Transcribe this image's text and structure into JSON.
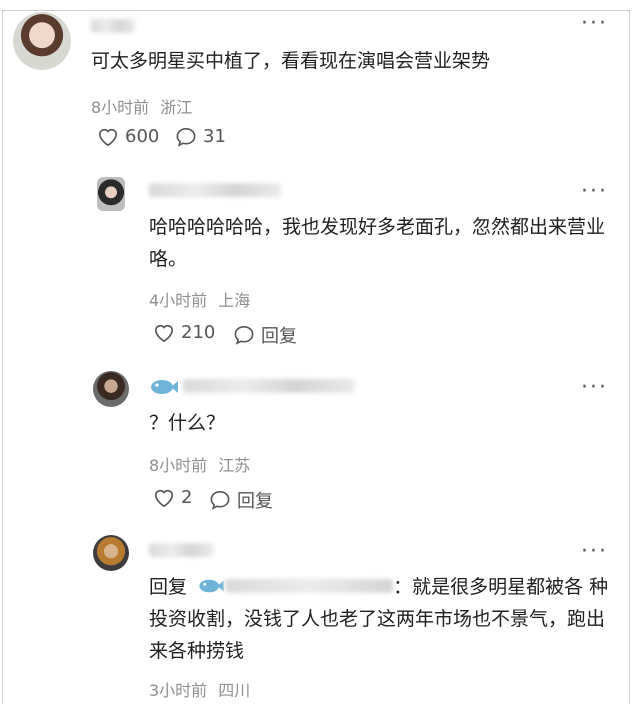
{
  "main_comment": {
    "text": "可太多明星买中植了，看看现在演唱会营业架势",
    "time": "8小时前",
    "location": "浙江",
    "likes": "600",
    "replies": "31"
  },
  "replies": [
    {
      "text": "哈哈哈哈哈哈，我也发现好多老面孔，忽然都出来营业咯。",
      "time": "4小时前",
      "location": "上海",
      "likes": "210",
      "reply_label": "回复"
    },
    {
      "text": "？什么？",
      "time": "8小时前",
      "location": "江苏",
      "likes": "2",
      "reply_label": "回复"
    },
    {
      "reply_prefix": "回复",
      "text_line1": "：就是很多明星都被各",
      "text_rest": "种投资收割，没钱了人也老了这两年市场也不景气，跑出来各种捞钱",
      "time": "3小时前",
      "location": "四川"
    }
  ],
  "icons": {
    "more": "more-dots-icon",
    "like": "heart-icon",
    "comment": "comment-bubble-icon",
    "badge": "fish-badge-icon"
  },
  "colors": {
    "badge": "#6fb4d8",
    "meta_text": "#8f8f8f"
  }
}
